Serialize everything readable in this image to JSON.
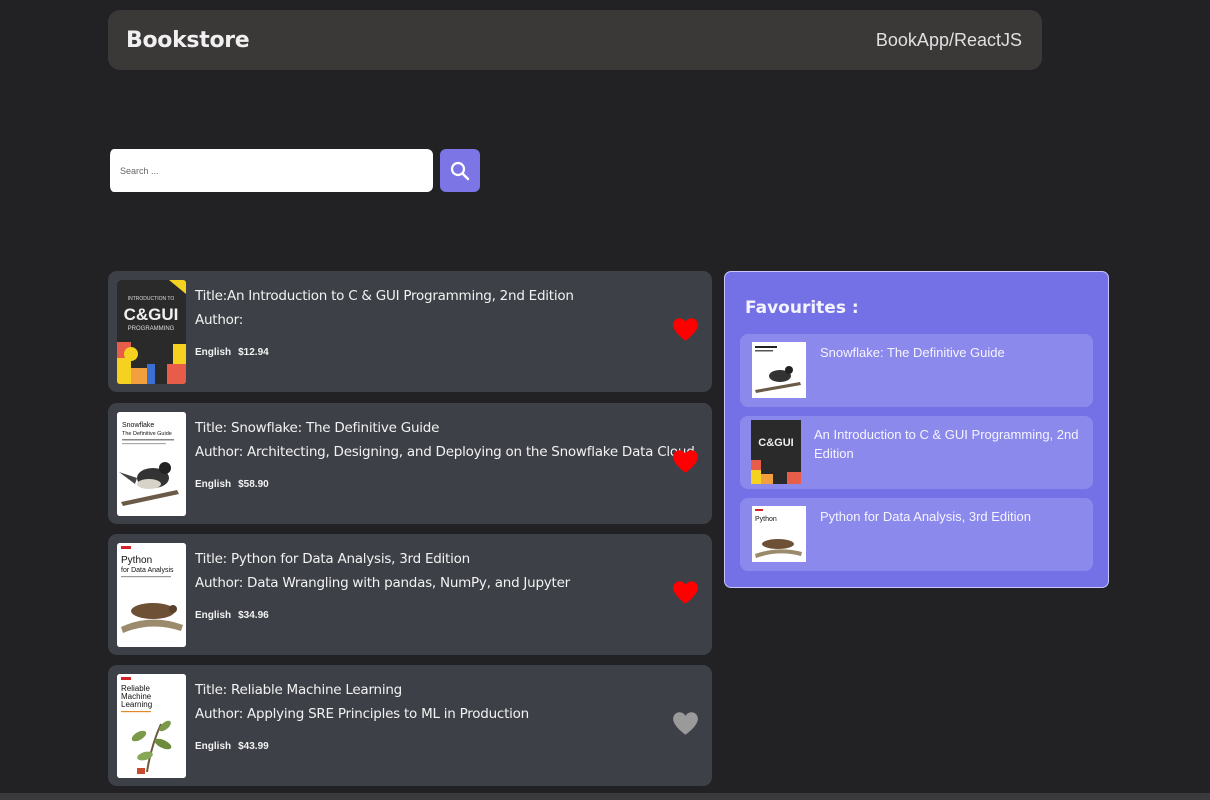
{
  "navbar": {
    "brand": "Bookstore",
    "right_text": "BookApp/ReactJS"
  },
  "search": {
    "placeholder": "Search ...",
    "value": ""
  },
  "books": [
    {
      "title": "Title:An Introduction to C & GUI Programming, 2nd Edition",
      "author": "Author:",
      "language": "English",
      "price": "$12.94",
      "favourite": true,
      "cover": {
        "name": "book-cover-c-gui",
        "text_lines": [
          "INTRODUCTION TO",
          "C&GUI",
          "PROGRAMMING"
        ]
      }
    },
    {
      "title": "Title: Snowflake: The Definitive Guide",
      "author": "Author: Architecting, Designing, and Deploying on the Snowflake Data Cloud",
      "language": "English",
      "price": "$58.90",
      "favourite": true,
      "cover": {
        "name": "book-cover-snowflake",
        "text_lines": [
          "Snowflake",
          "The Definitive Guide"
        ]
      }
    },
    {
      "title": "Title: Python for Data Analysis, 3rd Edition",
      "author": "Author: Data Wrangling with pandas, NumPy, and Jupyter",
      "language": "English",
      "price": "$34.96",
      "favourite": true,
      "cover": {
        "name": "book-cover-python-data-analysis",
        "text_lines": [
          "Python",
          "for Data Analysis"
        ]
      }
    },
    {
      "title": "Title: Reliable Machine Learning",
      "author": "Author: Applying SRE Principles to ML in Production",
      "language": "English",
      "price": "$43.99",
      "favourite": false,
      "cover": {
        "name": "book-cover-reliable-ml",
        "text_lines": [
          "Reliable",
          "Machine",
          "Learning"
        ]
      }
    }
  ],
  "favourites": {
    "heading": "Favourites :",
    "items": [
      {
        "label": "Snowflake: The Definitive Guide"
      },
      {
        "label": "An Introduction to C & GUI Programming, 2nd Edition"
      },
      {
        "label": "Python for Data Analysis, 3rd Edition"
      }
    ]
  },
  "colors": {
    "background": "#222225",
    "card": "#3d4047",
    "accent": "#7b75e6",
    "heart_active": "#ff0000",
    "heart_inactive": "#9a9a9a"
  },
  "icons": {
    "search": "search-icon",
    "heart": "heart-icon"
  }
}
